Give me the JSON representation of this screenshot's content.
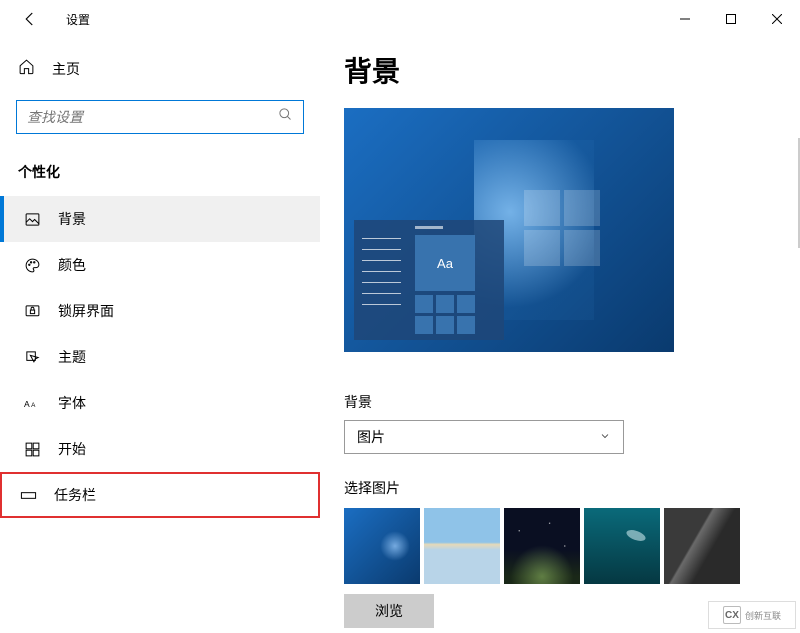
{
  "app": {
    "title": "设置"
  },
  "sidebar": {
    "home": "主页",
    "search_placeholder": "查找设置",
    "section": "个性化",
    "items": [
      {
        "label": "背景"
      },
      {
        "label": "颜色"
      },
      {
        "label": "锁屏界面"
      },
      {
        "label": "主题"
      },
      {
        "label": "字体"
      },
      {
        "label": "开始"
      },
      {
        "label": "任务栏"
      }
    ]
  },
  "main": {
    "title": "背景",
    "preview_text": "Aa",
    "bg_label": "背景",
    "bg_dropdown_value": "图片",
    "select_label": "选择图片",
    "browse": "浏览"
  },
  "watermark": {
    "logo": "CX",
    "text": "创新互联"
  }
}
